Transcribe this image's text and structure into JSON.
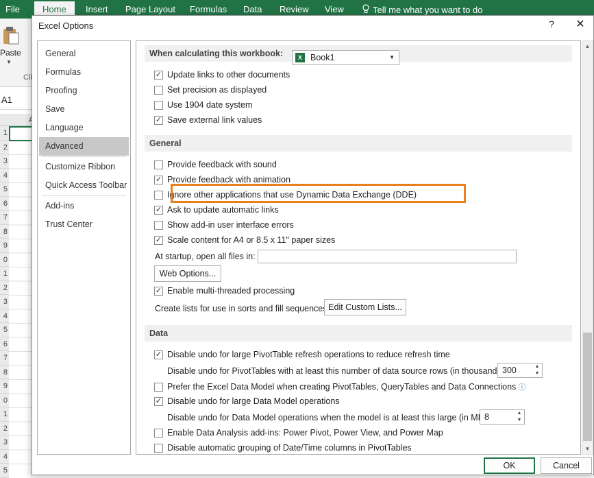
{
  "ribbon": {
    "tabs": [
      {
        "label": "File"
      },
      {
        "label": "Home"
      },
      {
        "label": "Insert"
      },
      {
        "label": "Page Layout"
      },
      {
        "label": "Formulas"
      },
      {
        "label": "Data"
      },
      {
        "label": "Review"
      },
      {
        "label": "View"
      }
    ],
    "active_tab": "Home",
    "tell_me": "Tell me what you want to do",
    "paste_label": "Paste",
    "clipboard_label": "Cli",
    "accent_color": "#217346"
  },
  "name_box": "A1",
  "sheet": {
    "column_header": "A",
    "row_headers": [
      "1",
      "2",
      "3",
      "4",
      "5",
      "6",
      "7",
      "8",
      "9",
      "0",
      "1",
      "2",
      "3",
      "4",
      "5",
      "6",
      "7",
      "8",
      "9",
      "0",
      "1",
      "2",
      "3",
      "4",
      "5"
    ]
  },
  "dialog": {
    "title": "Excel Options",
    "help": "?",
    "close": "✕",
    "nav": {
      "items": [
        {
          "label": "General"
        },
        {
          "label": "Formulas"
        },
        {
          "label": "Proofing"
        },
        {
          "label": "Save"
        },
        {
          "label": "Language"
        },
        {
          "label": "Advanced"
        },
        {
          "label": "Customize Ribbon"
        },
        {
          "label": "Quick Access Toolbar"
        },
        {
          "label": "Add-ins"
        },
        {
          "label": "Trust Center"
        }
      ],
      "selected": "Advanced"
    },
    "calc_section": {
      "header": "When calculating this workbook:",
      "workbook": "Book1",
      "options": [
        {
          "label": "Update links to other documents",
          "checked": true
        },
        {
          "label": "Set precision as displayed",
          "checked": false
        },
        {
          "label": "Use 1904 date system",
          "checked": false
        },
        {
          "label": "Save external link values",
          "checked": true
        }
      ]
    },
    "general_section": {
      "header": "General",
      "options": [
        {
          "label": "Provide feedback with sound",
          "checked": false
        },
        {
          "label": "Provide feedback with animation",
          "checked": true
        },
        {
          "label": "Ignore other applications that use Dynamic Data Exchange (DDE)",
          "checked": false
        },
        {
          "label": "Ask to update automatic links",
          "checked": true
        },
        {
          "label": "Show add-in user interface errors",
          "checked": false
        },
        {
          "label": "Scale content for A4 or 8.5 x 11\" paper sizes",
          "checked": true
        }
      ],
      "startup_label": "At startup, open all files in:",
      "startup_value": "",
      "web_options_button": "Web Options...",
      "multithread": {
        "label": "Enable multi-threaded processing",
        "checked": true
      },
      "custom_lists_label": "Create lists for use in sorts and fill sequences:",
      "custom_lists_button": "Edit Custom Lists..."
    },
    "data_section": {
      "header": "Data",
      "disable_undo_pivot": {
        "label": "Disable undo for large PivotTable refresh operations to reduce refresh time",
        "checked": true
      },
      "pivot_threshold_label": "Disable undo for PivotTables with at least this number of data source rows (in thousands):",
      "pivot_threshold_value": "300",
      "prefer_data_model": {
        "label": "Prefer the Excel Data Model when creating PivotTables, QueryTables and Data Connections",
        "checked": false
      },
      "disable_undo_model": {
        "label": "Disable undo for large Data Model operations",
        "checked": true
      },
      "model_threshold_label": "Disable undo for Data Model operations when the model is at least this large (in MB):",
      "model_threshold_value": "8",
      "analysis_addins": {
        "label": "Enable Data Analysis add-ins: Power Pivot, Power View, and Power Map",
        "checked": false
      },
      "disable_grouping": {
        "label": "Disable automatic grouping of Date/Time columns in PivotTables",
        "checked": false
      }
    },
    "ok_button": "OK",
    "cancel_button": "Cancel",
    "highlight_color": "#e8801e"
  }
}
